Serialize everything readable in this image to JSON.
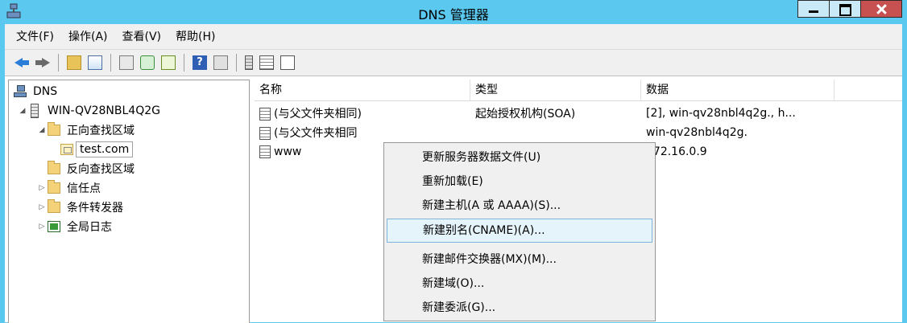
{
  "window": {
    "title": "DNS 管理器",
    "controls": [
      "minimize",
      "maximize",
      "close"
    ]
  },
  "menubar": [
    {
      "label": "文件(F)"
    },
    {
      "label": "操作(A)"
    },
    {
      "label": "查看(V)"
    },
    {
      "label": "帮助(H)"
    }
  ],
  "toolbar": {
    "icons": [
      "back-arrow-icon",
      "forward-arrow-icon",
      "up-folder-icon",
      "show-tree-icon",
      "properties-icon",
      "refresh-icon",
      "export-list-icon",
      "help-icon",
      "mmc-icon",
      "server-icon",
      "list-icon",
      "copy-icon"
    ]
  },
  "tree": {
    "root": {
      "label": "DNS",
      "icon": "dns-icon"
    },
    "server": {
      "label": "WIN-QV28NBL4Q2G",
      "icon": "server-icon",
      "expanded": true
    },
    "forward_zones": {
      "label": "正向查找区域",
      "icon": "folder-icon",
      "expanded": true
    },
    "zone": {
      "label": "test.com",
      "icon": "zone-icon",
      "selected": true
    },
    "reverse_zones": {
      "label": "反向查找区域",
      "icon": "folder-icon"
    },
    "trust_points": {
      "label": "信任点",
      "icon": "folder-icon",
      "collapsed": true
    },
    "conditional_forwarders": {
      "label": "条件转发器",
      "icon": "folder-icon",
      "collapsed": true
    },
    "global_logs": {
      "label": "全局日志",
      "icon": "log-icon",
      "collapsed": true
    }
  },
  "list": {
    "columns": [
      {
        "label": "名称"
      },
      {
        "label": "类型"
      },
      {
        "label": "数据"
      },
      {
        "label": ""
      }
    ],
    "rows": [
      {
        "name": "(与父文件夹相同)",
        "type": "起始授权机构(SOA)",
        "data": "[2], win-qv28nbl4q2g., h..."
      },
      {
        "name": "(与父文件夹相同",
        "type": "",
        "data": "win-qv28nbl4q2g."
      },
      {
        "name": "www",
        "type": "",
        "data": "172.16.0.9"
      }
    ]
  },
  "context_menu": {
    "items": [
      {
        "label": "更新服务器数据文件(U)"
      },
      {
        "label": "重新加载(E)"
      },
      {
        "label": "新建主机(A 或 AAAA)(S)..."
      },
      {
        "label": "新建别名(CNAME)(A)...",
        "highlighted": true
      },
      {
        "label": "新建邮件交换器(MX)(M)..."
      },
      {
        "label": "新建域(O)..."
      },
      {
        "label": "新建委派(G)..."
      }
    ]
  },
  "colors": {
    "titlebar": "#5ac8ef",
    "close_button": "#c75050",
    "menu_highlight": "#e5f3fb",
    "menu_highlight_border": "#7eb4dc"
  }
}
